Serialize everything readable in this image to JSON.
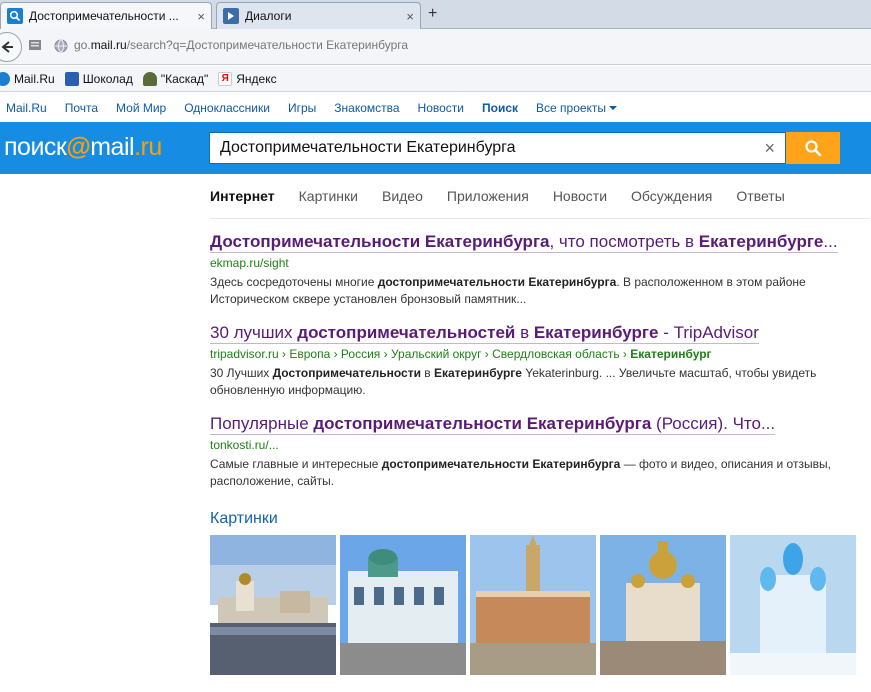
{
  "browser": {
    "tabs": [
      {
        "title": "Достопримечательности ...",
        "close": "×"
      },
      {
        "title": "Диалоги",
        "close": "×"
      }
    ],
    "new_tab": "+",
    "url_prefix": "go.",
    "url_domain": "mail.ru",
    "url_rest": "/search?q=Достопримечательности Екатеринбурга",
    "bookmarks": [
      "Mail.Ru",
      "Шоколад",
      "\"Каскад\"",
      "Яндекс"
    ]
  },
  "portal": {
    "links": [
      "Mail.Ru",
      "Почта",
      "Мой Мир",
      "Одноклассники",
      "Игры",
      "Знакомства",
      "Новости",
      "Поиск",
      "Все проекты"
    ]
  },
  "header": {
    "logo_left": "поиск",
    "logo_at": "@",
    "logo_mail": "mail",
    "logo_ru": ".ru",
    "query": "Достопримечательности Екатеринбурга",
    "clear": "×"
  },
  "verticals": [
    "Интернет",
    "Картинки",
    "Видео",
    "Приложения",
    "Новости",
    "Обсуждения",
    "Ответы"
  ],
  "results": [
    {
      "title_parts": [
        [
          "Достопримечательности Екатеринбурга",
          true
        ],
        [
          ", что посмотреть в ",
          false
        ],
        [
          "Екатеринбурге",
          true
        ],
        [
          "...",
          false
        ]
      ],
      "url_parts": [
        [
          "ekmap.ru/sight",
          false
        ]
      ],
      "snippet_parts": [
        [
          "Здесь сосредоточены многие ",
          false
        ],
        [
          "достопримечательности Екатеринбурга",
          true
        ],
        [
          ". В расположенном в этом районе Историческом сквере установлен бронзовый памятник...",
          false
        ]
      ]
    },
    {
      "title_parts": [
        [
          "30 лучших ",
          false
        ],
        [
          "достопримечательностей",
          true
        ],
        [
          " в ",
          false
        ],
        [
          "Екатеринбурге",
          true
        ],
        [
          " - TripAdvisor",
          false
        ]
      ],
      "url_parts": [
        [
          "tripadvisor.ru › Европа › Россия › Уральский округ › Свердловская область › ",
          false
        ],
        [
          "Екатеринбург",
          true
        ]
      ],
      "snippet_parts": [
        [
          "30 Лучших ",
          false
        ],
        [
          "Достопримечательности",
          true
        ],
        [
          " в ",
          false
        ],
        [
          "Екатеринбурге",
          true
        ],
        [
          " Yekaterinburg. ... Увеличьте масштаб, чтобы увидеть обновленную информацию.",
          false
        ]
      ]
    },
    {
      "title_parts": [
        [
          "Популярные ",
          false
        ],
        [
          "достопримечательности Екатеринбурга",
          true
        ],
        [
          " (Россия). Что...",
          false
        ]
      ],
      "url_parts": [
        [
          "tonkosti.ru/...",
          false
        ]
      ],
      "snippet_parts": [
        [
          "Самые главные и интересные ",
          false
        ],
        [
          "достопримечательности Екатеринбурга",
          true
        ],
        [
          " — фото и видео, описания и отзывы, расположение, сайты.",
          false
        ]
      ]
    }
  ],
  "images_heading": "Картинки",
  "images": [
    {
      "name": "church-embankment-image"
    },
    {
      "name": "sevastyanov-house-image"
    },
    {
      "name": "city-administration-image"
    },
    {
      "name": "church-on-blood-image"
    },
    {
      "name": "ice-town-image"
    }
  ],
  "colors": {
    "header_blue": "#168de2",
    "search_button": "#ffa31a",
    "visited_link": "#5a1b78",
    "url_green": "#208018",
    "link_blue": "#0b5ba7"
  }
}
